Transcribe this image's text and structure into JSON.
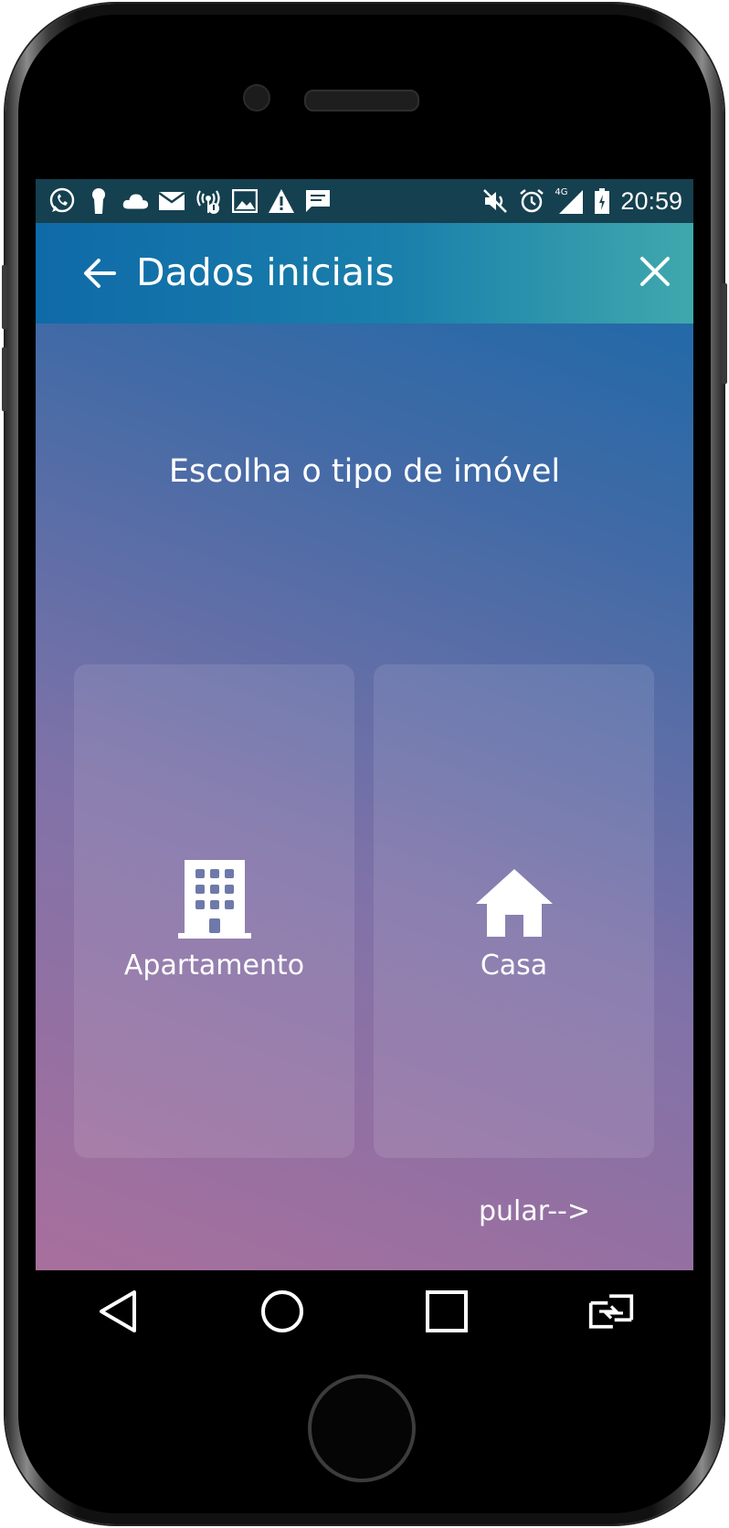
{
  "status_bar": {
    "left_icons": [
      "whatsapp-icon",
      "keyhole-icon",
      "cloud-icon",
      "mail-icon",
      "wireless-icon",
      "image-icon",
      "warning-icon",
      "message-icon"
    ],
    "right_icons": [
      "mute-icon",
      "alarm-icon",
      "signal-4g-icon",
      "battery-icon"
    ],
    "network_label": "4G",
    "time": "20:59",
    "background": "#15404f"
  },
  "app_bar": {
    "title": "Dados iniciais"
  },
  "main": {
    "prompt": "Escolha o tipo de imóvel",
    "options": [
      {
        "label": "Apartamento",
        "icon": "building-icon"
      },
      {
        "label": "Casa",
        "icon": "house-icon"
      }
    ],
    "skip_label": "pular-->"
  },
  "nav_bar": {
    "buttons": [
      "back-triangle-icon",
      "home-circle-icon",
      "recents-square-icon",
      "switch-app-icon"
    ]
  },
  "colors": {
    "gradient_top": "#1168a9",
    "gradient_bottom": "#a86f9c",
    "app_bar_start": "#0f6aa8",
    "app_bar_end": "#3fa8ad"
  }
}
